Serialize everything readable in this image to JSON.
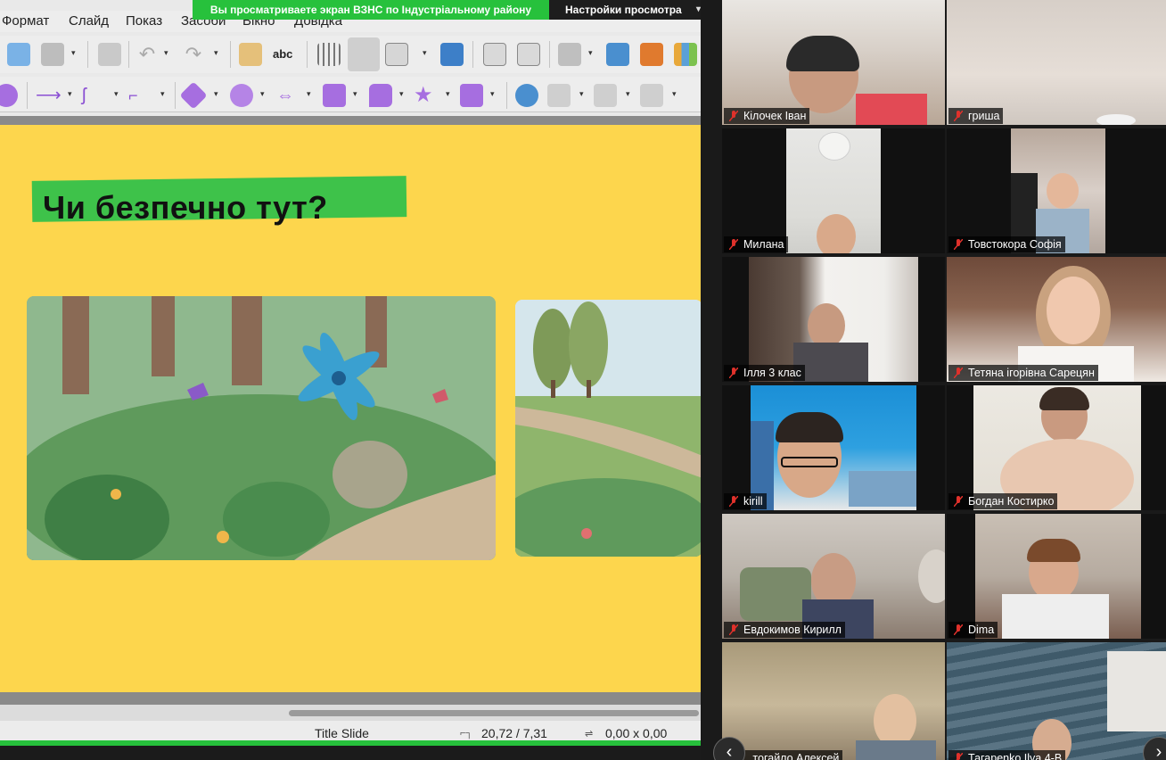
{
  "screen_share": {
    "banner": "Вы просматриваете экран ВЗНС по Індустріальному району",
    "view_settings": "Настройки просмотра"
  },
  "menu": [
    "Формат",
    "Слайд",
    "Показ",
    "Засоби",
    "Вікно",
    "Довідка"
  ],
  "slide": {
    "title": "Чи безпечно тут?"
  },
  "status_bar": {
    "layout": "Title Slide",
    "position": "20,72 / 7,31",
    "size": "0,00 x 0,00"
  },
  "participants": [
    {
      "name": "Кілочек Іван"
    },
    {
      "name": "гриша"
    },
    {
      "name": "Милана"
    },
    {
      "name": "Товстокора Софія"
    },
    {
      "name": "Ілля 3 клас"
    },
    {
      "name": "Тетяна ігорівна Сарецян"
    },
    {
      "name": "kirill"
    },
    {
      "name": "Богдан Костирко"
    },
    {
      "name": "Евдокимов Кирилл"
    },
    {
      "name": "Dima"
    },
    {
      "name": "...тогайло Алексей"
    },
    {
      "name": "Тагарenko Ilya 4-В"
    }
  ],
  "gallery_nav": {
    "prev": "‹",
    "next": "›"
  },
  "colors": {
    "share_green": "#27c13c",
    "slide_yellow": "#fdd64d",
    "title_highlight": "#3ec24a",
    "mic_muted": "#e0312b"
  }
}
